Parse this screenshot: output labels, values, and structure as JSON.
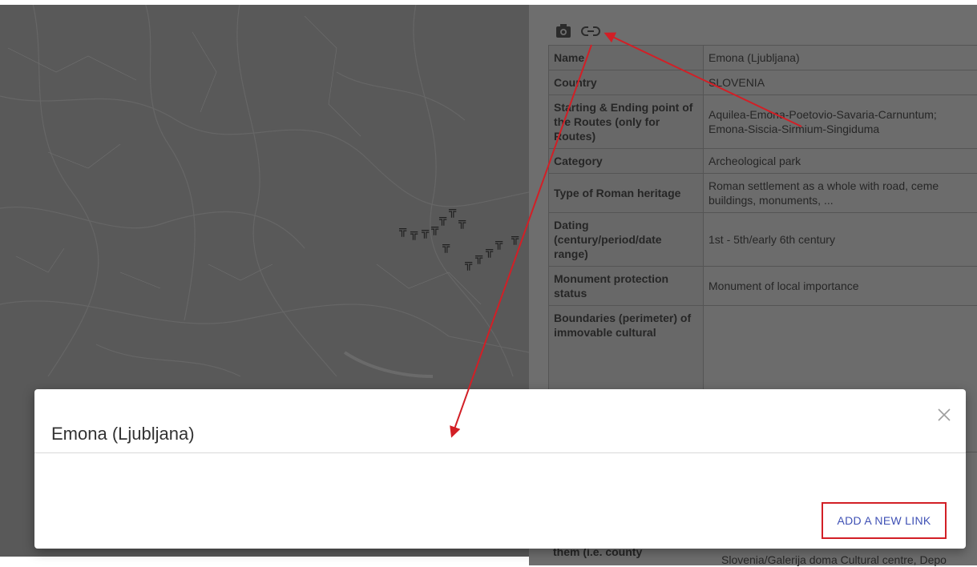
{
  "toolbar": {
    "icons": [
      "camera-icon",
      "link-icon"
    ]
  },
  "info_table": {
    "rows": [
      {
        "key": "Name",
        "value": "Emona (Ljubljana)"
      },
      {
        "key": "Country",
        "value": "SLOVENIA"
      },
      {
        "key": "Starting & Ending point of the Routes (only for Routes)",
        "value": "Aquilea-Emona-Poetovio-Savaria-Carnuntum;\nEmona-Siscia-Sirmium-Singiduma"
      },
      {
        "key": "Category",
        "value": "Archeological park"
      },
      {
        "key": "Type of Roman heritage",
        "value": "Roman settlement as a whole with road, ceme\nbuildings, monuments, ..."
      },
      {
        "key": "Dating (century/period/date range)",
        "value": "1st - 5th/early 6th century"
      },
      {
        "key": "Monument protection status",
        "value": "Monument of local importance"
      },
      {
        "key": "Boundaries (perimeter) of immovable cultural",
        "value": ""
      }
    ],
    "peek_partial_key": "them (i.e. county",
    "peek_partial_value": "Slovenia/Galerija doma Cultural centre, Depo"
  },
  "modal": {
    "title": "Emona (Ljubljana)",
    "add_link_label": "ADD A NEW LINK"
  },
  "colors": {
    "accent": "#3f51b5",
    "annotation": "#d21f26"
  }
}
